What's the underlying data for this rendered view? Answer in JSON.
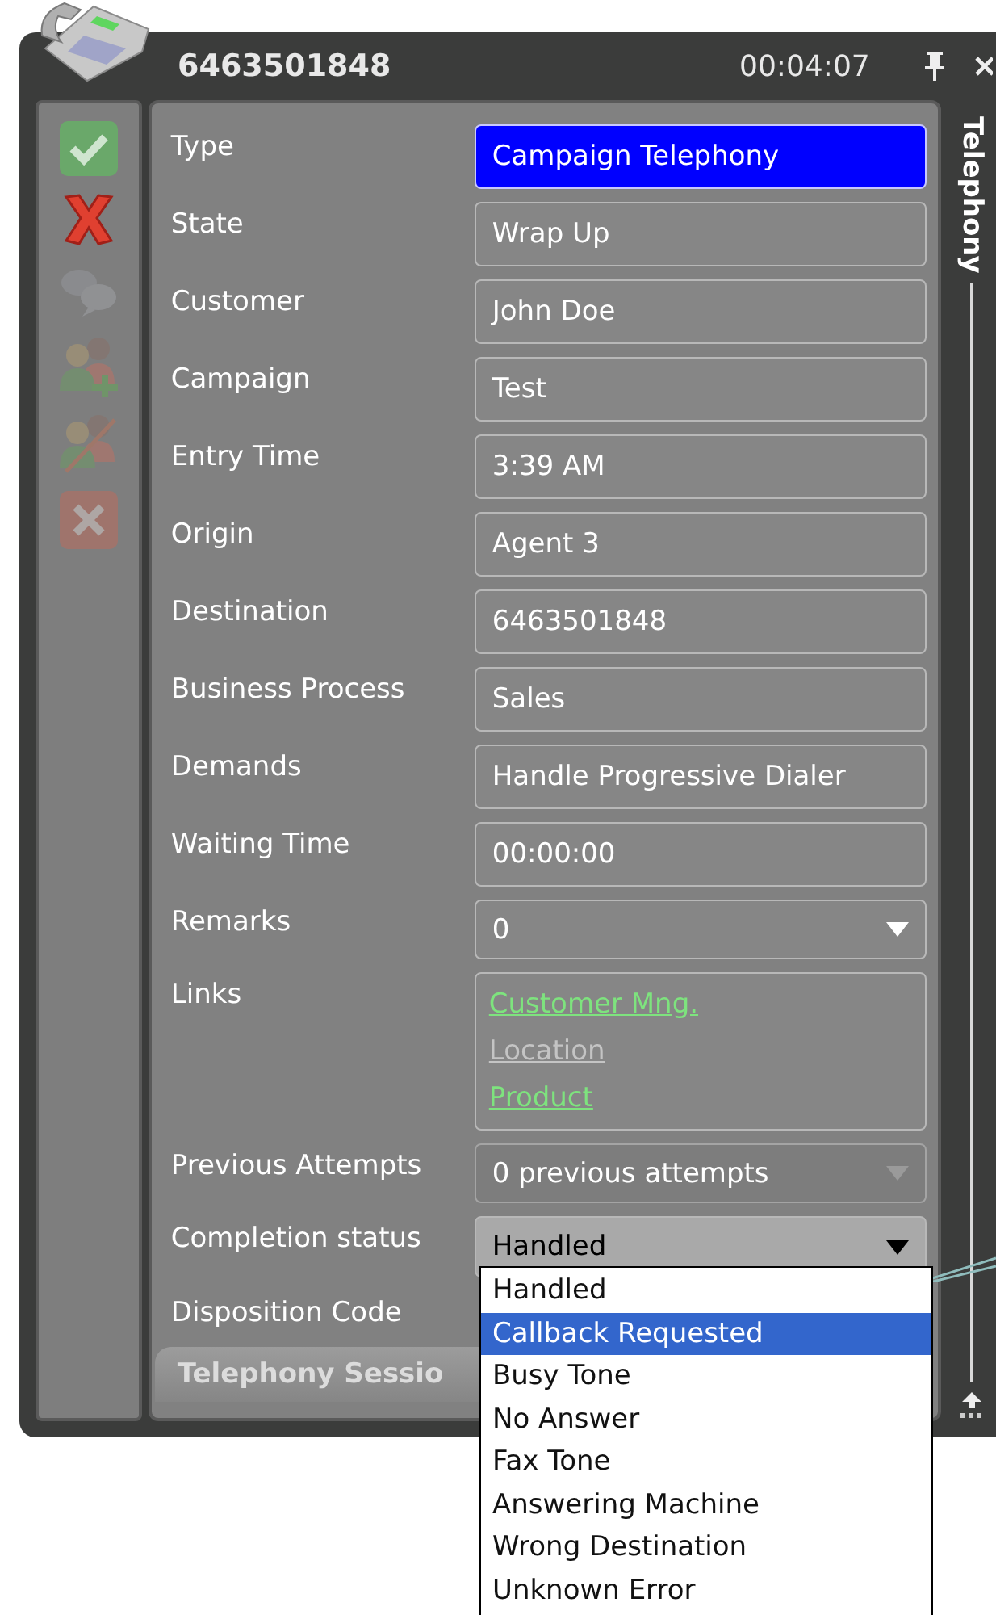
{
  "header": {
    "number": "6463501848",
    "timer": "00:04:07"
  },
  "toolbar": [
    {
      "disabled": false
    },
    {
      "disabled": false
    },
    {
      "disabled": true
    },
    {
      "disabled": true
    },
    {
      "disabled": true
    },
    {
      "disabled": true
    }
  ],
  "fields": [
    {
      "kind": "text",
      "label": "Type",
      "value": "Campaign Telephony",
      "highlighted": true
    },
    {
      "kind": "text",
      "label": "State",
      "value": "Wrap Up",
      "highlighted": false
    },
    {
      "kind": "text",
      "label": "Customer",
      "value": "John Doe",
      "highlighted": false
    },
    {
      "kind": "text",
      "label": "Campaign",
      "value": "Test",
      "highlighted": false
    },
    {
      "kind": "text",
      "label": "Entry Time",
      "value": "3:39 AM",
      "highlighted": false
    },
    {
      "kind": "text",
      "label": "Origin",
      "value": "Agent 3",
      "highlighted": false
    },
    {
      "kind": "text",
      "label": "Destination",
      "value": "6463501848",
      "highlighted": false
    },
    {
      "kind": "text",
      "label": "Business Process",
      "value": "Sales",
      "highlighted": false
    },
    {
      "kind": "text",
      "label": "Demands",
      "value": "Handle Progressive Dialer",
      "highlighted": false
    },
    {
      "kind": "text",
      "label": "Waiting Time",
      "value": "00:00:00",
      "highlighted": false
    },
    {
      "kind": "select",
      "label": "Remarks",
      "value": "0",
      "disabled": false,
      "expanded": false
    },
    {
      "kind": "links",
      "label": "Links",
      "links": [
        {
          "text": "Customer Mng.",
          "disabled": false
        },
        {
          "text": "Location",
          "disabled": true
        },
        {
          "text": "Product",
          "disabled": false
        }
      ]
    },
    {
      "kind": "select",
      "label": "Previous Attempts",
      "value": "0 previous attempts",
      "disabled": true,
      "expanded": false
    },
    {
      "kind": "select",
      "label": "Completion status",
      "value": "Handled",
      "disabled": false,
      "expanded": true
    },
    {
      "kind": "label",
      "label": "Disposition Code"
    }
  ],
  "dropdown": [
    {
      "text": "Handled",
      "selected": false
    },
    {
      "text": "Callback Requested",
      "selected": true
    },
    {
      "text": "Busy Tone",
      "selected": false
    },
    {
      "text": "No Answer",
      "selected": false
    },
    {
      "text": "Fax Tone",
      "selected": false
    },
    {
      "text": "Answering Machine",
      "selected": false
    },
    {
      "text": "Wrong Destination",
      "selected": false
    },
    {
      "text": "Unknown Error",
      "selected": false
    }
  ],
  "bottom_tab": "Telephony Sessio",
  "side_tab": "Telephony"
}
